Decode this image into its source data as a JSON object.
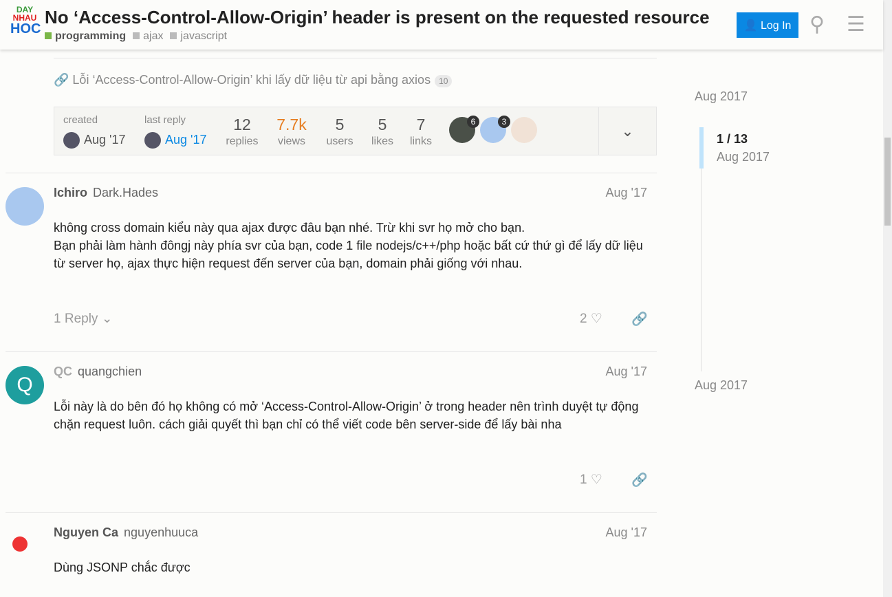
{
  "header": {
    "logo": [
      "DAY",
      "NHAU",
      "HOC"
    ],
    "title": "No ‘Access-Control-Allow-Origin’ header is present on the requested resource",
    "tags": [
      {
        "label": "programming",
        "color": "#7ab648"
      },
      {
        "label": "ajax",
        "color": "#bbbbbb"
      },
      {
        "label": "javascript",
        "color": "#bbbbbb"
      }
    ],
    "login": "Log In"
  },
  "linked_topic": {
    "title": "Lỗi ‘Access-Control-Allow-Origin’ khi lấy dữ liệu từ api bằng axios",
    "clicks": "10"
  },
  "topic_map": {
    "created_label": "created",
    "created": "Aug '17",
    "last_reply_label": "last reply",
    "last_reply": "Aug '17",
    "stats": [
      {
        "value": "12",
        "label": "replies"
      },
      {
        "value": "7.7k",
        "label": "views"
      },
      {
        "value": "5",
        "label": "users"
      },
      {
        "value": "5",
        "label": "likes"
      },
      {
        "value": "7",
        "label": "links"
      }
    ],
    "participant_counts": [
      "6",
      "3"
    ]
  },
  "posts": [
    {
      "name": "Ichiro",
      "username": "Dark.Hades",
      "date": "Aug '17",
      "text": "không cross domain kiểu này qua ajax được đâu bạn nhé. Trừ khi svr họ mở cho bạn.\nBạn phải làm hành đôngj này phía svr của bạn, code 1 file nodejs/c++/php hoặc bất cứ thứ gì để lấy dữ liệu từ server họ, ajax thực hiện request đến server của bạn, domain phải giống với nhau.",
      "replies": "1 Reply",
      "likes": "2"
    },
    {
      "name": "QC",
      "username": "quangchien",
      "date": "Aug '17",
      "avatar_letter": "Q",
      "text": "Lỗi này là do bên đó họ không có mở ‘Access-Control-Allow-Origin’ ở trong header nên trình duyệt tự động chặn request luôn. cách giải quyết thì bạn chỉ có thể viết code bên server-side để lấy bài nha",
      "likes": "1"
    },
    {
      "name": "Nguyen Ca",
      "username": "nguyenhuuca",
      "date": "Aug '17",
      "text": "Dùng JSONP chắc được"
    }
  ],
  "timeline": {
    "start": "Aug 2017",
    "position": "1 / 13",
    "position_date": "Aug 2017",
    "end": "Aug 2017"
  }
}
